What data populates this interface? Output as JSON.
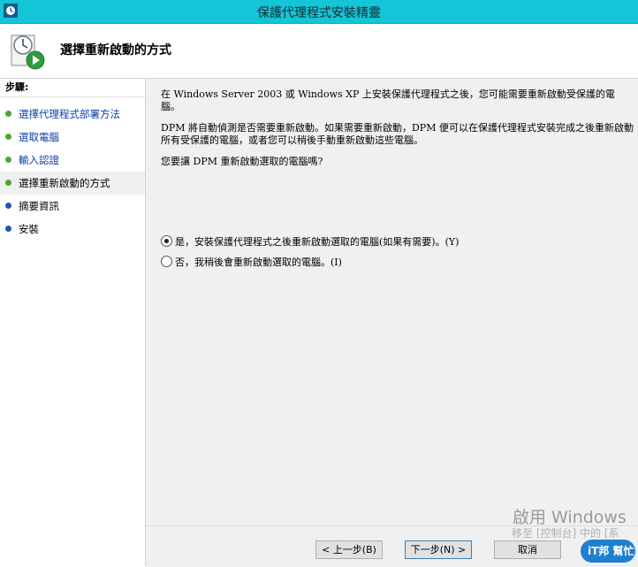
{
  "window": {
    "title": "保護代理程式安裝精靈"
  },
  "header": {
    "title": "選擇重新啟動的方式",
    "icon": "clock-play-icon"
  },
  "steps": {
    "title": "步驟:",
    "items": [
      {
        "label": "選擇代理程式部署方法",
        "state": "done"
      },
      {
        "label": "選取電腦",
        "state": "done"
      },
      {
        "label": "輸入認證",
        "state": "done"
      },
      {
        "label": "選擇重新啟動的方式",
        "state": "current"
      },
      {
        "label": "摘要資訊",
        "state": "pending"
      },
      {
        "label": "安裝",
        "state": "pending"
      }
    ]
  },
  "content": {
    "para1": "在 Windows Server 2003 或 Windows XP 上安裝保護代理程式之後，您可能需要重新啟動受保護的電腦。",
    "para2": "DPM 將自動偵測是否需要重新啟動。如果需要重新啟動，DPM 便可以在保護代理程式安裝完成之後重新啟動所有受保護的電腦，或者您可以稍後手動重新啟動這些電腦。",
    "question": "您要讓 DPM 重新啟動選取的電腦嗎?",
    "option_yes": "是，安裝保護代理程式之後重新啟動選取的電腦(如果有需要)。(Y)",
    "option_no": "否，我稍後會重新啟動選取的電腦。(I)",
    "selected": "yes"
  },
  "buttons": {
    "back": "< 上一步(B)",
    "next": "下一步(N) >",
    "cancel": "取消"
  },
  "overlay": {
    "activate_title": "啟用 Windows",
    "activate_hint": "移至 [控制台] 中的 [系",
    "badge": "iT邦 幫忙"
  },
  "colors": {
    "titlebar": "#15c4d6",
    "step_done_dot": "#4aa832",
    "step_pending_dot": "#1f55b5",
    "link": "#0a3ea8"
  }
}
